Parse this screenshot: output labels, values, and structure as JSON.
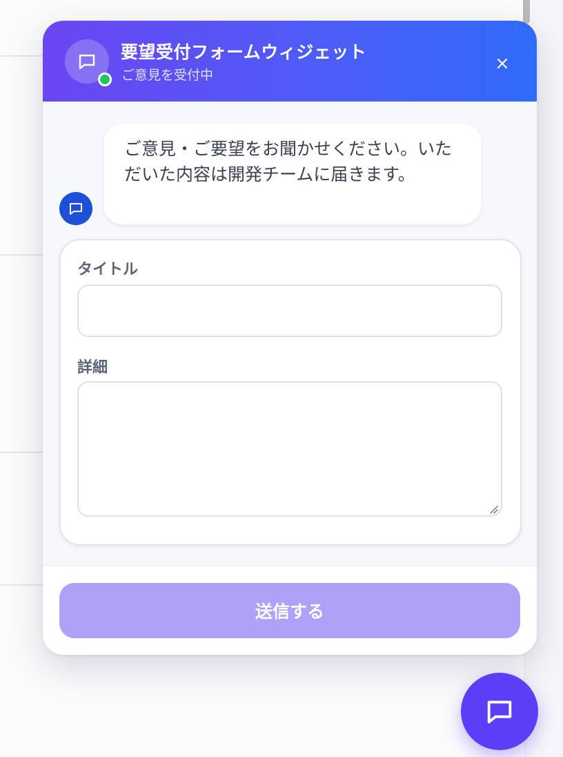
{
  "widget": {
    "title": "要望受付フォームウィジェット",
    "status": "ご意見を受付中",
    "close_icon": "close-icon"
  },
  "message": {
    "text": "ご意見・ご要望をお聞かせください。いただいた内容は開発チームに届きます。"
  },
  "form": {
    "title_label": "タイトル",
    "title_value": "",
    "detail_label": "詳細",
    "detail_value": ""
  },
  "footer": {
    "submit_label": "送信する"
  },
  "colors": {
    "header_gradient_start": "#6a46f2",
    "header_gradient_end": "#2f6af9",
    "online": "#22c55e",
    "bot_avatar": "#1e4fd8",
    "submit_disabled": "#afa1f8",
    "fab": "#5b3ef5"
  },
  "icons": {
    "header_avatar": "chat-bubble-icon",
    "bot_avatar": "chat-bubble-icon",
    "launcher": "chat-bubble-icon"
  }
}
